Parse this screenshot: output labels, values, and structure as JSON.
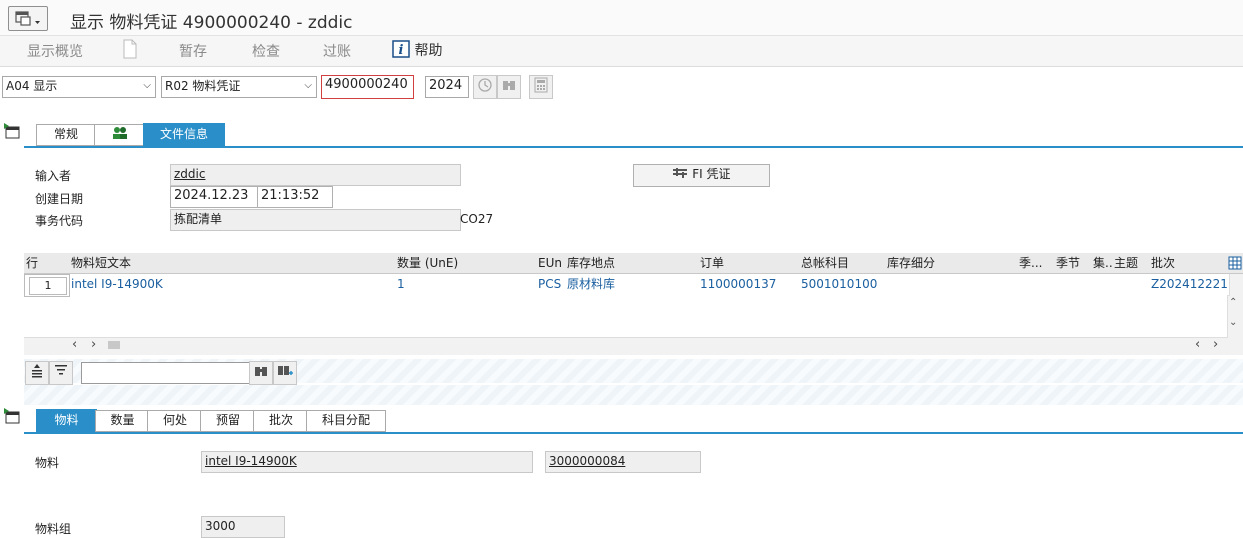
{
  "window": {
    "title": "显示 物料凭证 4900000240 - zddic"
  },
  "toolbar": {
    "overview": "显示概览",
    "hold": "暂存",
    "check": "检查",
    "post": "过账",
    "help": "帮助"
  },
  "selection": {
    "action": "A04 显示",
    "reference": "R02 物料凭证",
    "doc_number": "4900000240",
    "year": "2024"
  },
  "header_tabs": {
    "general": "常规",
    "doc_info": "文件信息"
  },
  "doc_info": {
    "entered_by_label": "输入者",
    "entered_by": "zddic",
    "created_label": "创建日期",
    "created_date": "2024.12.23",
    "created_time": "21:13:52",
    "tcode_label": "事务代码",
    "tcode_desc": "拣配清单",
    "tcode": "CO27",
    "fi_doc_button": "FI 凭证"
  },
  "grid": {
    "columns": [
      "行",
      "物料短文本",
      "数量 (UnE)",
      "EUn",
      "库存地点",
      "订单",
      "总帐科目",
      "库存细分",
      "季...",
      "季节",
      "集...",
      "主题",
      "批次"
    ],
    "rows": [
      {
        "line": "1",
        "material_text": "intel I9-14900K",
        "qty": "1",
        "unit": "PCS",
        "storage_loc": "原材料库",
        "order": "1100000137",
        "gl_account": "5001010100",
        "stock_segment": "",
        "season_cat": "",
        "season": "",
        "collection": "",
        "theme": "",
        "batch": "Z202412221"
      }
    ]
  },
  "item_tabs": {
    "material": "物料",
    "quantity": "数量",
    "where": "何处",
    "reservation": "预留",
    "batch": "批次",
    "account_assignment": "科目分配"
  },
  "item_detail": {
    "material_label": "物料",
    "material_desc": "intel I9-14900K",
    "material_number": "3000000084",
    "material_group_label": "物料组",
    "material_group": "3000"
  },
  "colors": {
    "accent": "#2a8fc9",
    "link": "#1a5fa0"
  }
}
